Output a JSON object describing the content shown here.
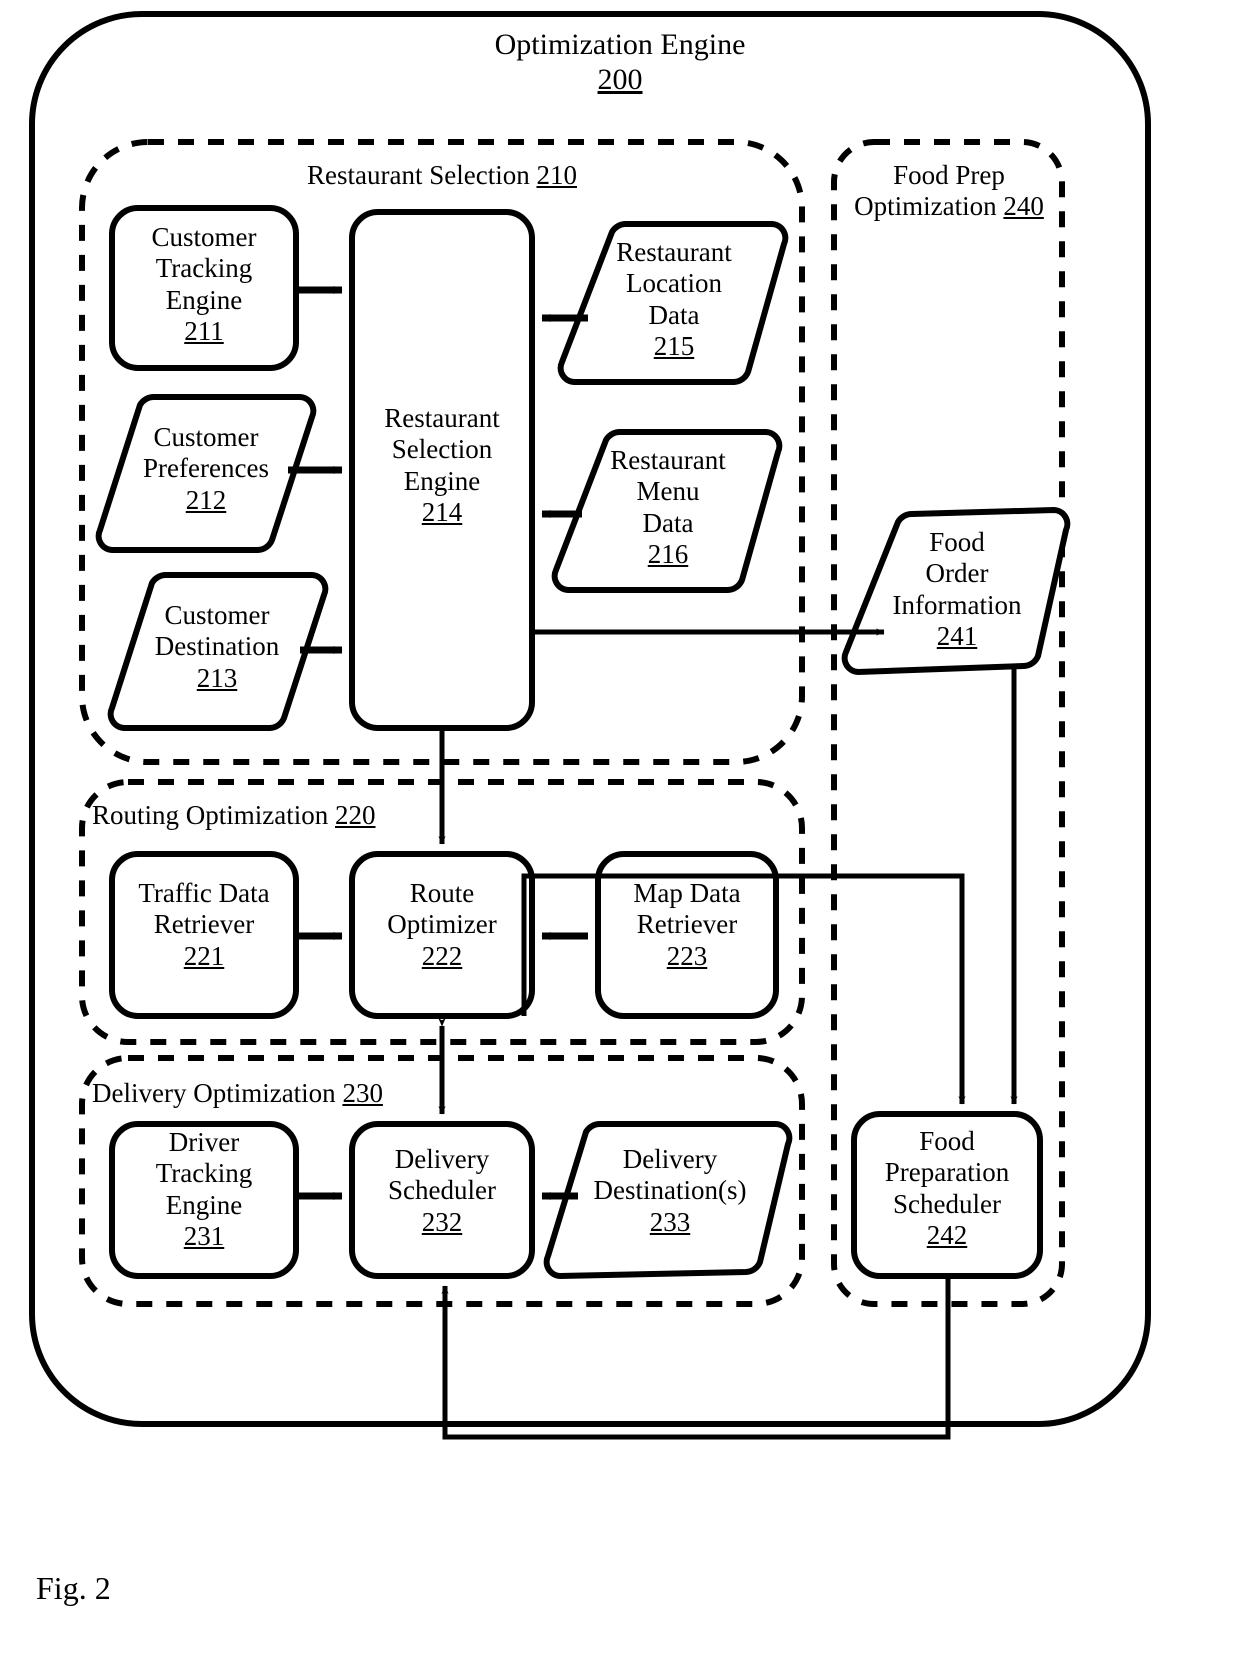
{
  "figure": {
    "caption": "Fig. 2",
    "title": "Optimization Engine",
    "title_ref": "200"
  },
  "groups": [
    {
      "id": "restaurant-selection",
      "label": "Restaurant Selection",
      "ref": "210"
    },
    {
      "id": "food-prep-optimization",
      "label_line1": "Food Prep",
      "label_line2": "Optimization",
      "ref": "240"
    },
    {
      "id": "routing-optimization",
      "label": "Routing Optimization",
      "ref": "220"
    },
    {
      "id": "delivery-optimization",
      "label": "Delivery Optimization",
      "ref": "230"
    }
  ],
  "nodes": [
    {
      "id": "customer-tracking-engine",
      "shape": "process",
      "lines": [
        "Customer",
        "Tracking",
        "Engine"
      ],
      "ref": "211"
    },
    {
      "id": "customer-preferences",
      "shape": "data",
      "lines": [
        "Customer",
        "Preferences"
      ],
      "ref": "212"
    },
    {
      "id": "customer-destination",
      "shape": "data",
      "lines": [
        "Customer",
        "Destination"
      ],
      "ref": "213"
    },
    {
      "id": "restaurant-selection-engine",
      "shape": "process",
      "lines": [
        "Restaurant",
        "Selection",
        "Engine"
      ],
      "ref": "214"
    },
    {
      "id": "restaurant-location-data",
      "shape": "data",
      "lines": [
        "Restaurant",
        "Location",
        "Data"
      ],
      "ref": "215"
    },
    {
      "id": "restaurant-menu-data",
      "shape": "data",
      "lines": [
        "Restaurant",
        "Menu",
        "Data"
      ],
      "ref": "216"
    },
    {
      "id": "traffic-data-retriever",
      "shape": "process",
      "lines": [
        "Traffic Data",
        "Retriever"
      ],
      "ref": "221"
    },
    {
      "id": "route-optimizer",
      "shape": "process",
      "lines": [
        "Route",
        "Optimizer"
      ],
      "ref": "222"
    },
    {
      "id": "map-data-retriever",
      "shape": "process",
      "lines": [
        "Map Data",
        "Retriever"
      ],
      "ref": "223"
    },
    {
      "id": "driver-tracking-engine",
      "shape": "process",
      "lines": [
        "Driver",
        "Tracking",
        "Engine"
      ],
      "ref": "231"
    },
    {
      "id": "delivery-scheduler",
      "shape": "process",
      "lines": [
        "Delivery",
        "Scheduler"
      ],
      "ref": "232"
    },
    {
      "id": "delivery-destinations",
      "shape": "data",
      "lines": [
        "Delivery",
        "Destination(s)"
      ],
      "ref": "233"
    },
    {
      "id": "food-order-information",
      "shape": "data",
      "lines": [
        "Food",
        "Order",
        "Information"
      ],
      "ref": "241"
    },
    {
      "id": "food-preparation-scheduler",
      "shape": "process",
      "lines": [
        "Food",
        "Preparation",
        "Scheduler"
      ],
      "ref": "242"
    }
  ],
  "edges": [
    {
      "from": "customer-tracking-engine",
      "to": "restaurant-selection-engine",
      "kind": "arrow"
    },
    {
      "from": "customer-preferences",
      "to": "restaurant-selection-engine",
      "kind": "arrow"
    },
    {
      "from": "customer-destination",
      "to": "restaurant-selection-engine",
      "kind": "arrow"
    },
    {
      "from": "restaurant-location-data",
      "to": "restaurant-selection-engine",
      "kind": "arrow"
    },
    {
      "from": "restaurant-menu-data",
      "to": "restaurant-selection-engine",
      "kind": "arrow"
    },
    {
      "from": "restaurant-selection-engine",
      "to": "food-order-information",
      "kind": "arrow"
    },
    {
      "from": "restaurant-selection-engine",
      "to": "route-optimizer",
      "kind": "arrow"
    },
    {
      "from": "traffic-data-retriever",
      "to": "route-optimizer",
      "kind": "arrow"
    },
    {
      "from": "map-data-retriever",
      "to": "route-optimizer",
      "kind": "arrow"
    },
    {
      "from": "route-optimizer",
      "to": "delivery-scheduler",
      "kind": "double-arrow"
    },
    {
      "from": "driver-tracking-engine",
      "to": "delivery-scheduler",
      "kind": "arrow"
    },
    {
      "from": "delivery-destinations",
      "to": "delivery-scheduler",
      "kind": "arrow"
    },
    {
      "from": "food-order-information",
      "to": "food-preparation-scheduler",
      "kind": "arrow"
    },
    {
      "from": "route-optimizer",
      "to": "food-preparation-scheduler",
      "kind": "arrow"
    },
    {
      "from": "food-preparation-scheduler",
      "to": "delivery-scheduler",
      "kind": "arrow"
    }
  ],
  "style": {
    "stroke": "#000000",
    "fill": "#ffffff"
  }
}
